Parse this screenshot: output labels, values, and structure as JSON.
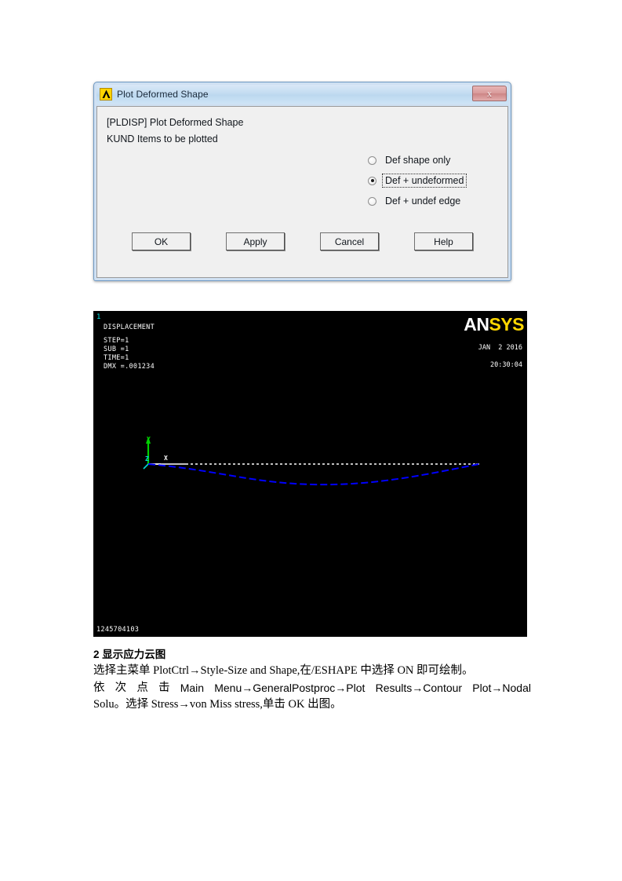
{
  "dialog": {
    "title": "Plot Deformed Shape",
    "icon": "ansys-lambda-icon",
    "close_label": "x",
    "command_line": "[PLDISP]  Plot Deformed Shape",
    "param_line": "KUND   Items to be plotted",
    "options": [
      {
        "label": "Def shape only",
        "checked": false
      },
      {
        "label": "Def + undeformed",
        "checked": true
      },
      {
        "label": "Def + undef edge",
        "checked": false
      }
    ],
    "buttons": [
      {
        "label": "OK"
      },
      {
        "label": "Apply"
      },
      {
        "label": "Cancel"
      },
      {
        "label": "Help"
      }
    ]
  },
  "plot": {
    "window_number": "1",
    "title": "DISPLACEMENT",
    "meta": "STEP=1\nSUB =1\nTIME=1\nDMX =.001234",
    "logo_part1": "AN",
    "logo_part2": "SYS",
    "date": "JAN  2 2016",
    "time": "20:30:04",
    "filename": "1245704103",
    "triad": {
      "y_label": "Y",
      "x_label": "X",
      "z_label": "Z"
    },
    "colors": {
      "background": "#000000",
      "undeformed": "#ffffff",
      "deformed": "#0000ff",
      "axis_y": "#00d000",
      "axis_z": "#00d8d8",
      "logo_accent": "#ffd700"
    }
  },
  "document": {
    "heading_number": "2",
    "heading_text": "显示应力云图",
    "paragraph_lines": [
      "选择主菜单 PlotCtrl→Style-Size and Shape,在/ESHAPE 中选择 ON 即可绘制。",
      "依次点击 Main Menu→GeneralPostproc→Plot Results→Contour Plot→Nodal",
      "Solu。选择 Stress→von Miss stress,单击 OK 出图。"
    ],
    "line2_segments": [
      "依",
      "次",
      "点",
      "击",
      "Main",
      "Menu→GeneralPostproc→Plot",
      "Results→Contour",
      "Plot→Nodal"
    ]
  }
}
